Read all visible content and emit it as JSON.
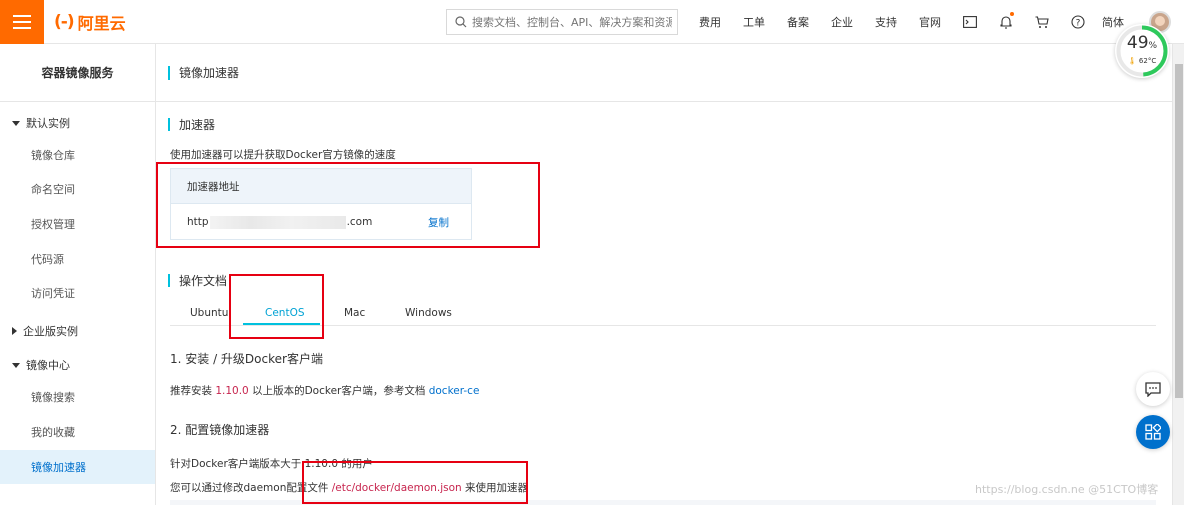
{
  "topbar": {
    "logo_mark": "(-)",
    "logo_text": "阿里云",
    "search_placeholder": "搜索文档、控制台、API、解决方案和资源",
    "nav": [
      "费用",
      "工单",
      "备案",
      "企业",
      "支持",
      "官网"
    ],
    "lang": "简体",
    "icons": [
      "terminal-icon",
      "bell-icon",
      "cart-icon",
      "help-icon"
    ]
  },
  "gauge": {
    "percent": "49",
    "percent_unit": "%",
    "temperature": "62°C",
    "level": 0.49
  },
  "sidebar": {
    "title": "容器镜像服务",
    "groups": [
      {
        "label": "默认实例",
        "expanded": true,
        "items": [
          "镜像仓库",
          "命名空间",
          "授权管理",
          "代码源",
          "访问凭证"
        ]
      },
      {
        "label": "企业版实例",
        "expanded": false,
        "items": []
      },
      {
        "label": "镜像中心",
        "expanded": true,
        "items": [
          "镜像搜索",
          "我的收藏",
          "镜像加速器"
        ]
      }
    ],
    "active_item": "镜像加速器"
  },
  "page": {
    "title": "镜像加速器"
  },
  "accelerator": {
    "heading": "加速器",
    "desc": "使用加速器可以提升获取Docker官方镜像的速度",
    "table_header": "加速器地址",
    "address_prefix": "http",
    "address_suffix": ".com",
    "copy_label": "复制"
  },
  "docs": {
    "heading": "操作文档",
    "tabs": [
      "Ubuntu",
      "CentOS",
      "Mac",
      "Windows"
    ],
    "active_tab": "CentOS",
    "step1_title": "1. 安装 / 升级Docker客户端",
    "step1_text_a": "推荐安装 ",
    "step1_version": "1.10.0",
    "step1_text_b": " 以上版本的Docker客户端，参考文档 ",
    "step1_link": "docker-ce",
    "step2_title": "2. 配置镜像加速器",
    "step2_line1": "针对Docker客户端版本大于 1.10.0 的用户",
    "step2_line2_a": "您可以通过修改daemon配置文件 ",
    "step2_path": "/etc/docker/daemon.json",
    "step2_line2_b": " 来使用加速器"
  },
  "watermark": "https://blog.csdn.ne @51CTO博客",
  "colors": {
    "brand": "#ff6a00",
    "accent": "#00c1de",
    "link": "#0070cc",
    "highlight": "#c7254e",
    "annotation": "#e60012"
  }
}
